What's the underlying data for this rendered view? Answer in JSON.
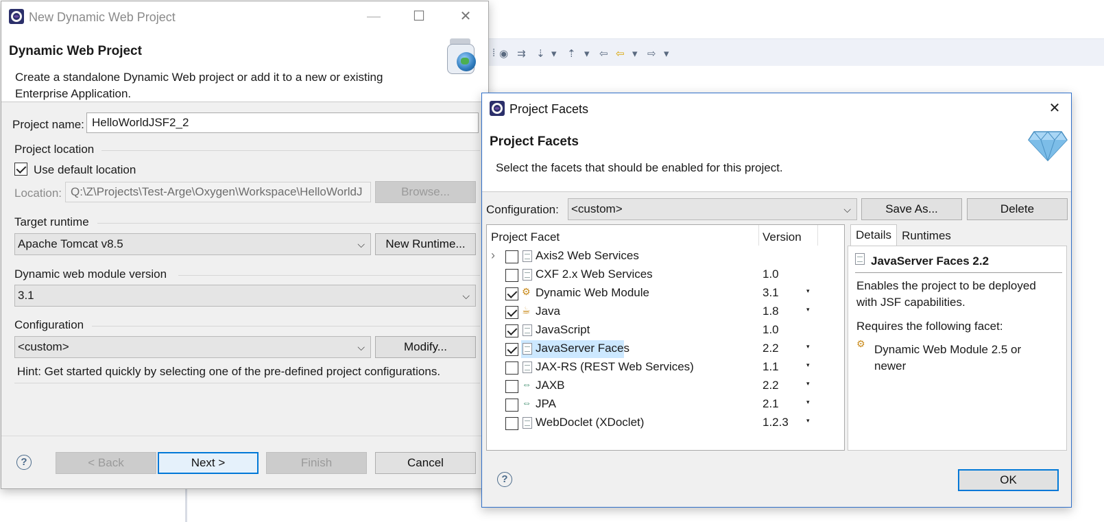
{
  "background": {
    "toolbar_glyphs": [
      "⁞",
      "◉",
      "⇉",
      "⇣",
      "▾",
      "⇡",
      "▾",
      "⇦",
      "⇦",
      "▾",
      "⇨",
      "▾"
    ]
  },
  "wizard": {
    "window_title": "New Dynamic Web Project",
    "banner_title": "Dynamic Web Project",
    "banner_desc_line1": "Create a standalone Dynamic Web project or add it to a new or existing",
    "banner_desc_line2": "Enterprise Application.",
    "project_name_label": "Project name:",
    "project_name_value": "HelloWorldJSF2_2",
    "project_location_label": "Project location",
    "use_default_location_label": "Use default location",
    "use_default_location_checked": true,
    "location_label": "Location:",
    "location_value": "Q:\\Z\\Projects\\Test-Arge\\Oxygen\\Workspace\\HelloWorldJ",
    "browse_button": "Browse...",
    "target_runtime_label": "Target runtime",
    "target_runtime_value": "Apache Tomcat v8.5",
    "new_runtime_button": "New Runtime...",
    "module_version_label": "Dynamic web module version",
    "module_version_value": "3.1",
    "configuration_label": "Configuration",
    "configuration_value": "<custom>",
    "modify_button": "Modify...",
    "hint": "Hint: Get started quickly by selecting one of the pre-defined project configurations.",
    "back_button": "< Back",
    "next_button": "Next >",
    "finish_button": "Finish",
    "cancel_button": "Cancel",
    "help_glyph": "?"
  },
  "facets_dialog": {
    "window_title": "Project Facets",
    "close_glyph": "✕",
    "banner_title": "Project Facets",
    "banner_desc": "Select the facets that should be enabled for this project.",
    "configuration_label": "Configuration:",
    "configuration_value": "<custom>",
    "save_as_button": "Save As...",
    "delete_button": "Delete",
    "col_facet": "Project Facet",
    "col_version": "Version",
    "facets": [
      {
        "name": "Axis2 Web Services",
        "version": "",
        "checked": false,
        "expandable": true,
        "dropdown": false,
        "icon": "document-icon"
      },
      {
        "name": "CXF 2.x Web Services",
        "version": "1.0",
        "checked": false,
        "expandable": false,
        "dropdown": false,
        "icon": "document-icon"
      },
      {
        "name": "Dynamic Web Module",
        "version": "3.1",
        "checked": true,
        "expandable": false,
        "dropdown": true,
        "icon": "web-module-icon"
      },
      {
        "name": "Java",
        "version": "1.8",
        "checked": true,
        "expandable": false,
        "dropdown": true,
        "icon": "java-icon"
      },
      {
        "name": "JavaScript",
        "version": "1.0",
        "checked": true,
        "expandable": false,
        "dropdown": false,
        "icon": "document-icon"
      },
      {
        "name": "JavaServer Faces",
        "version": "2.2",
        "checked": true,
        "expandable": false,
        "dropdown": true,
        "icon": "document-icon",
        "selected": true
      },
      {
        "name": "JAX-RS (REST Web Services)",
        "version": "1.1",
        "checked": false,
        "expandable": false,
        "dropdown": true,
        "icon": "document-icon"
      },
      {
        "name": "JAXB",
        "version": "2.2",
        "checked": false,
        "expandable": false,
        "dropdown": true,
        "icon": "jaxb-icon"
      },
      {
        "name": "JPA",
        "version": "2.1",
        "checked": false,
        "expandable": false,
        "dropdown": true,
        "icon": "jpa-icon"
      },
      {
        "name": "WebDoclet (XDoclet)",
        "version": "1.2.3",
        "checked": false,
        "expandable": false,
        "dropdown": true,
        "icon": "document-icon"
      }
    ],
    "expand_glyph": "›",
    "dropdown_glyph": "▾",
    "tab_details": "Details",
    "tab_runtimes": "Runtimes",
    "details_title": "JavaServer Faces 2.2",
    "details_desc_line1": "Enables the project to be deployed",
    "details_desc_line2": "with JSF capabilities.",
    "requires_label": "Requires the following facet:",
    "requires_item_line1": "Dynamic Web Module 2.5 or",
    "requires_item_line2": "newer",
    "ok_button": "OK",
    "help_glyph": "?"
  }
}
